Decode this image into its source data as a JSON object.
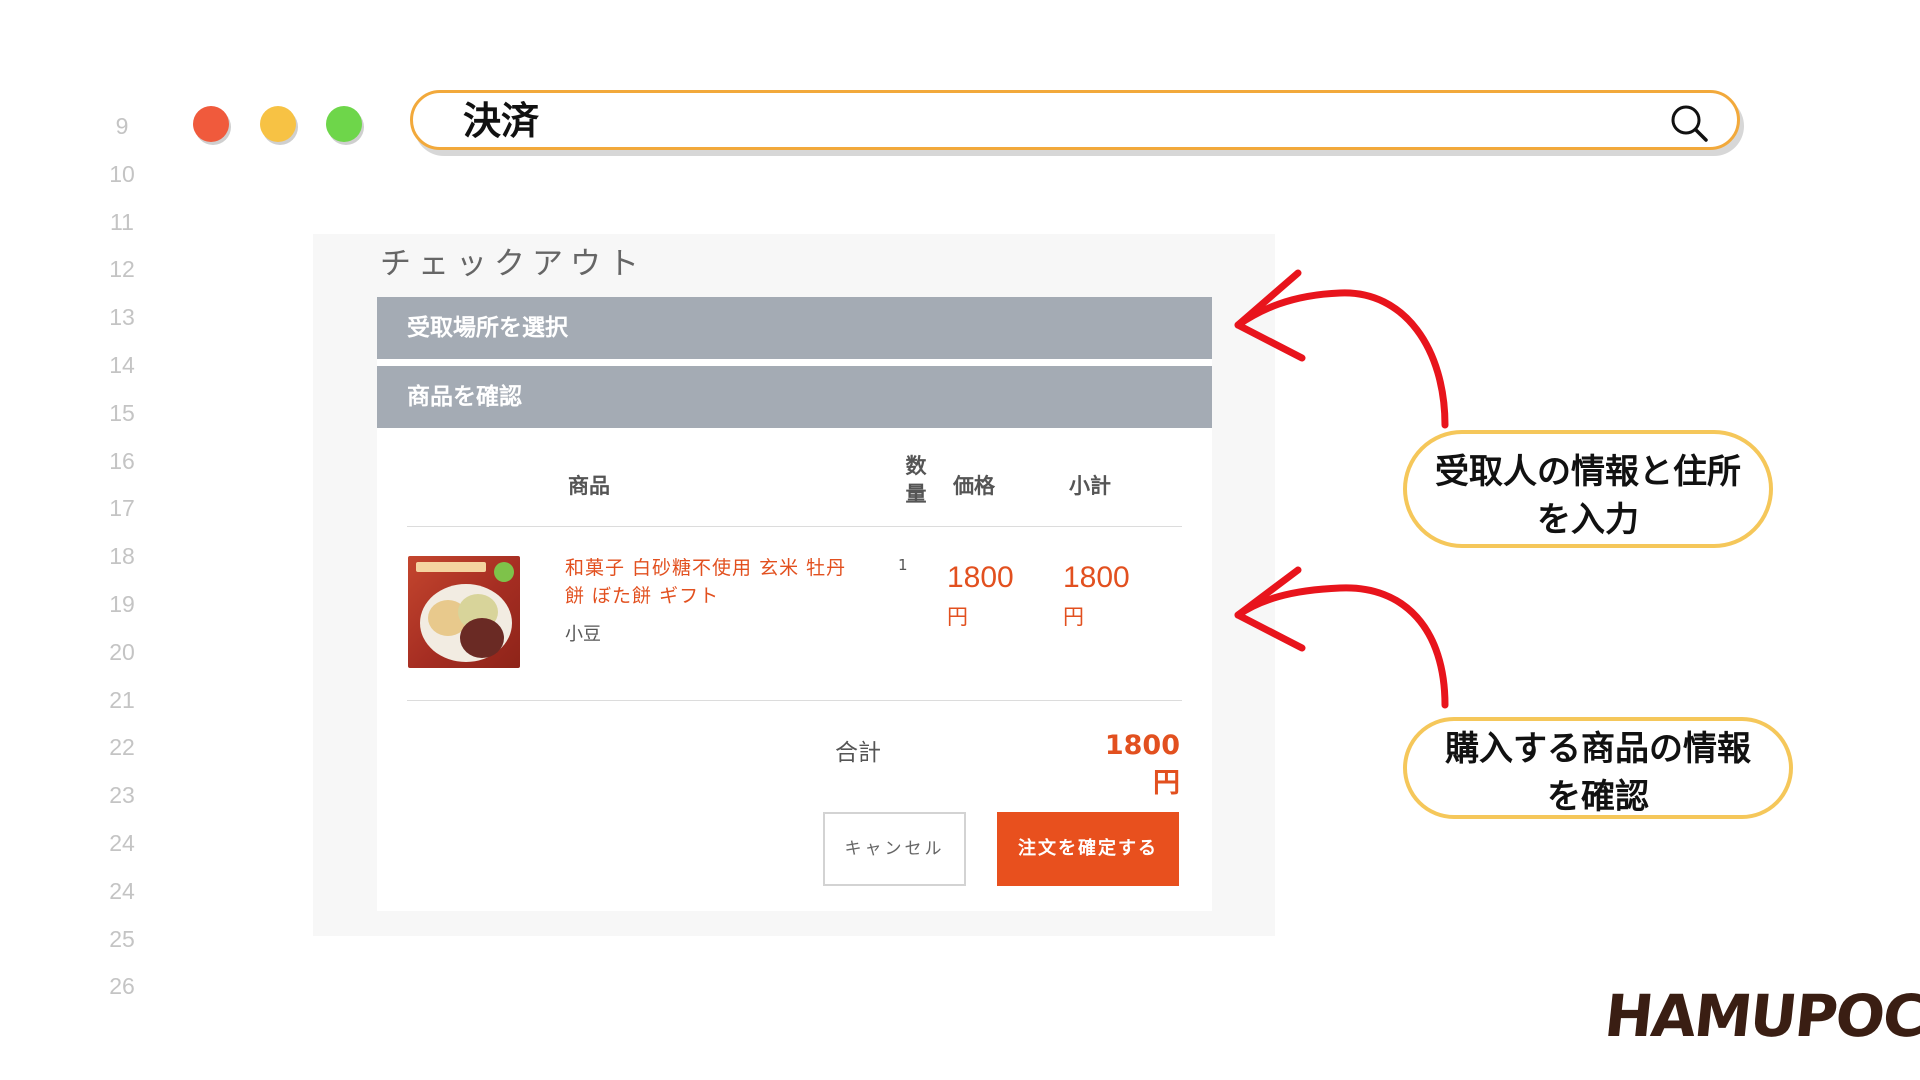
{
  "line_numbers": [
    "9",
    "10",
    "11",
    "12",
    "13",
    "14",
    "15",
    "16",
    "17",
    "18",
    "19",
    "20",
    "21",
    "22",
    "23",
    "24",
    "24",
    "25",
    "26"
  ],
  "window": {
    "controls": [
      "close",
      "minimize",
      "maximize"
    ]
  },
  "address_bar": {
    "text": "決済",
    "icon": "search-icon"
  },
  "checkout": {
    "title": "チェックアウト",
    "sections": [
      "受取場所を選択",
      "商品を確認"
    ],
    "table": {
      "headers": {
        "product": "商品",
        "quantity_line1": "数",
        "quantity_line2": "量",
        "price": "価格",
        "subtotal": "小計"
      },
      "rows": [
        {
          "name": "和菓子 白砂糖不使用 玄米 牡丹餅 ぼた餅 ギフト",
          "variant": "小豆",
          "quantity": "1",
          "price": "1800",
          "price_unit": "円",
          "subtotal": "1800",
          "subtotal_unit": "円"
        }
      ]
    },
    "total_label": "合計",
    "total_value": "1800円",
    "cancel_label": "キャンセル",
    "confirm_label": "注文を確定する"
  },
  "annotations": [
    {
      "line1": "受取人の情報と住所",
      "line2": "を入力"
    },
    {
      "line1": "購入する商品の情報",
      "line2": "を確認"
    }
  ],
  "logo": "HAMUPOCHI",
  "colors": {
    "accent": "#e8501e",
    "accordion": "#a4abb4",
    "callout_border": "#f5c75a",
    "arrow": "#e8141c"
  }
}
